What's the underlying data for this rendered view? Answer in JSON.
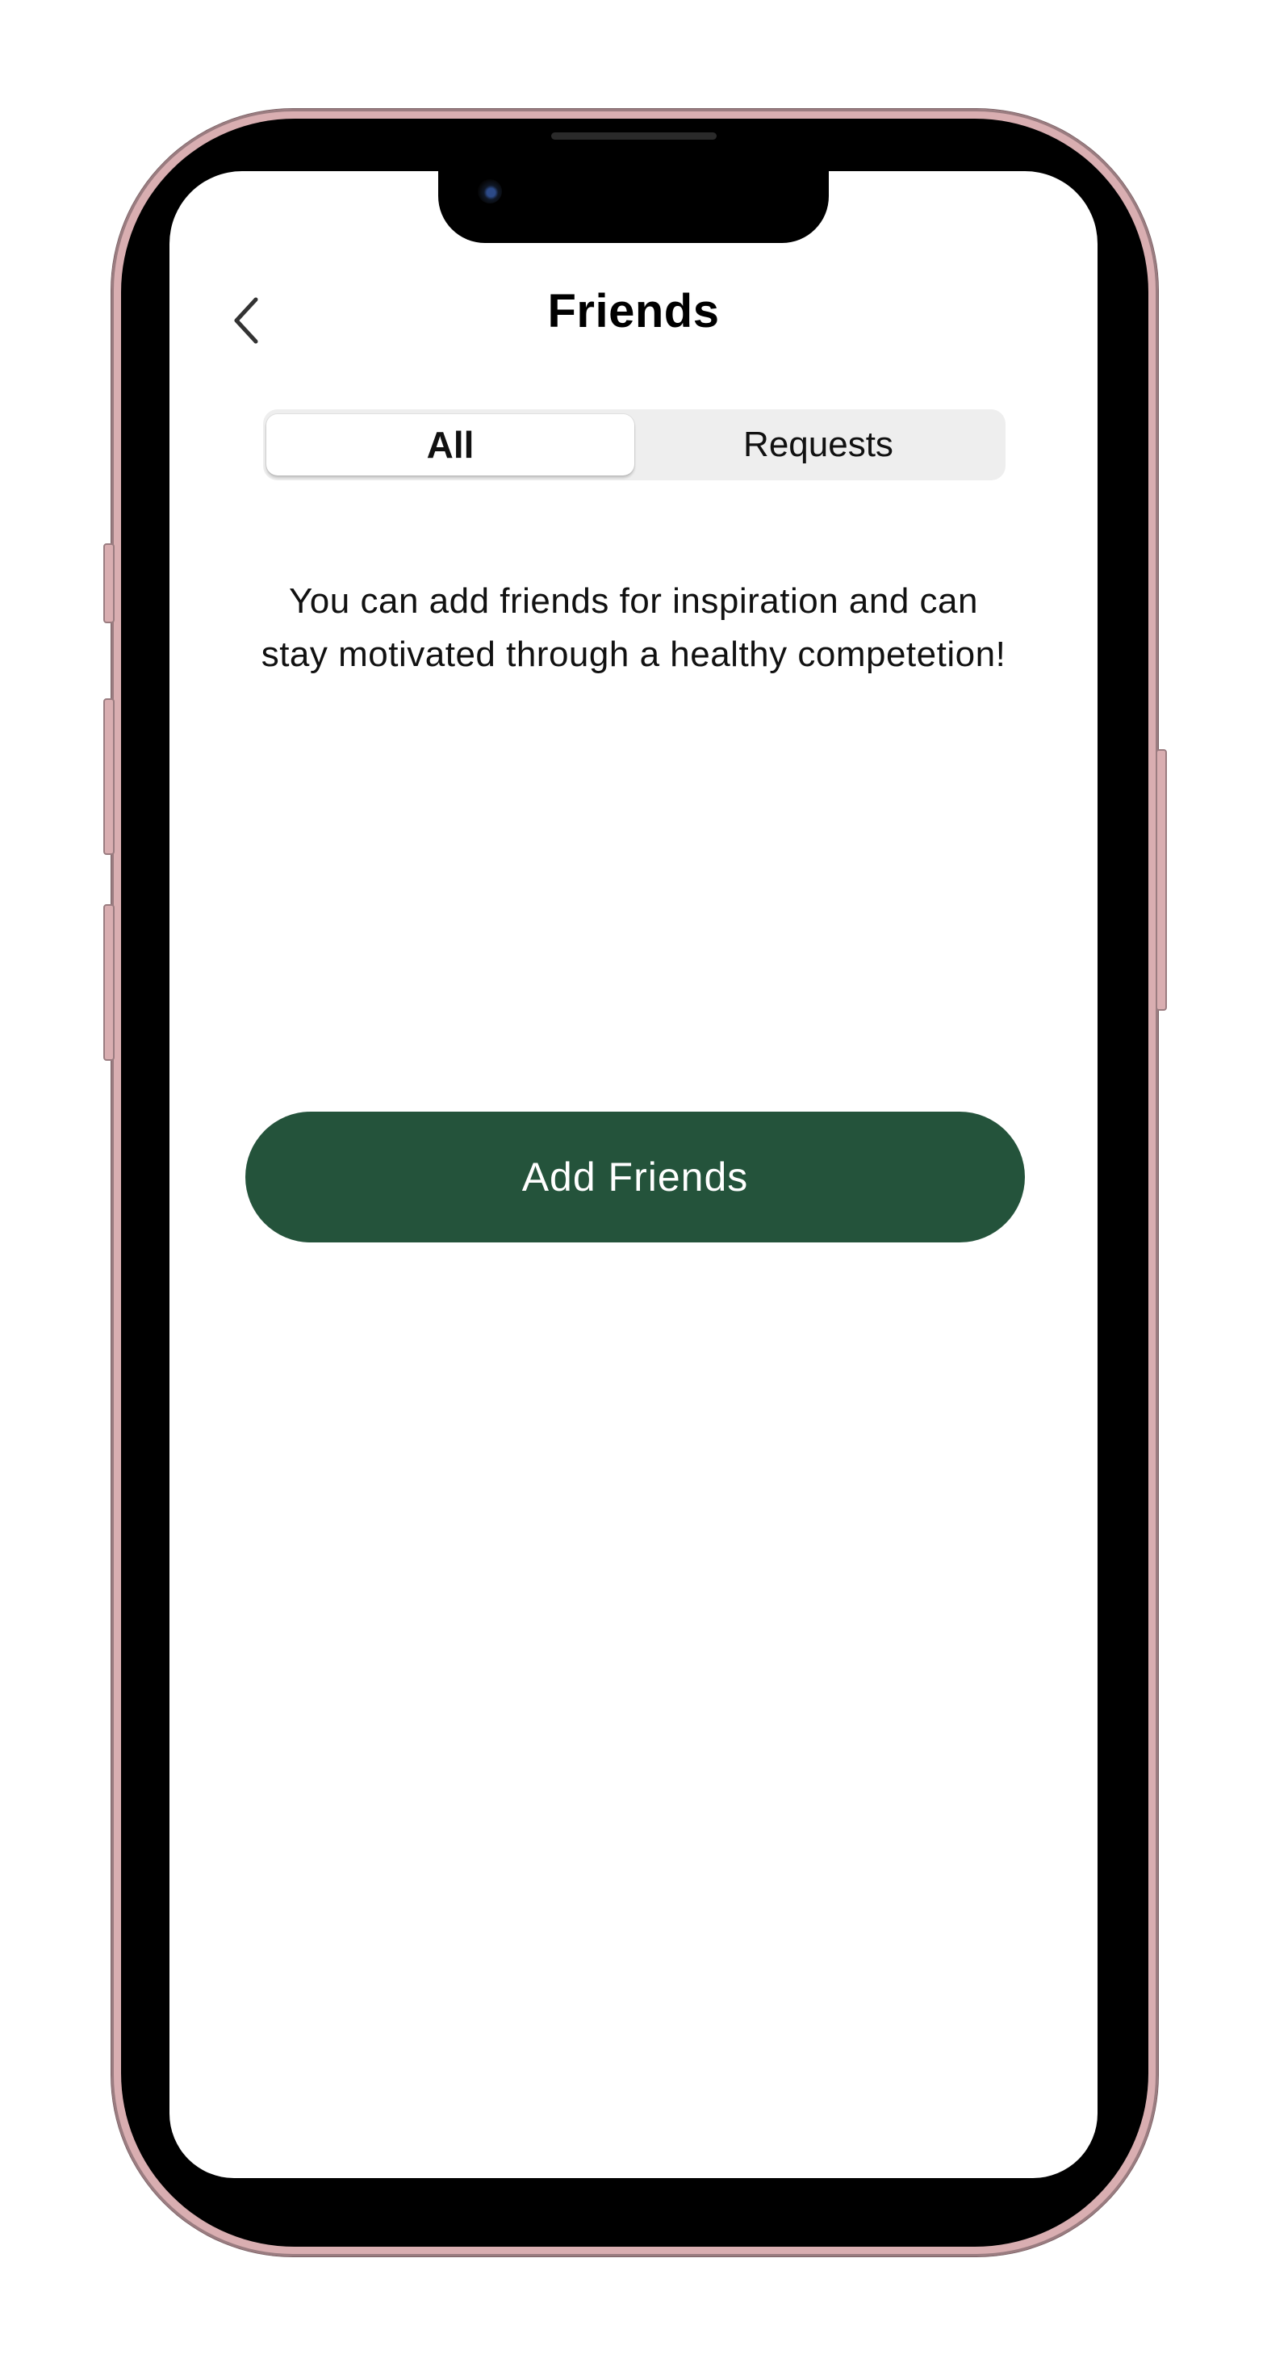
{
  "header": {
    "title": "Friends",
    "back_icon": "chevron-left-icon"
  },
  "tabs": [
    {
      "label": "All",
      "active": true
    },
    {
      "label": "Requests",
      "active": false
    }
  ],
  "info": {
    "text": "You  can add friends for inspiration and can\nstay motivated through a healthy competetion!"
  },
  "actions": {
    "add_friends_label": "Add Friends"
  },
  "colors": {
    "accent": "#24533b",
    "frame": "#d9aeb1",
    "segment_bg": "#eeeeee"
  }
}
